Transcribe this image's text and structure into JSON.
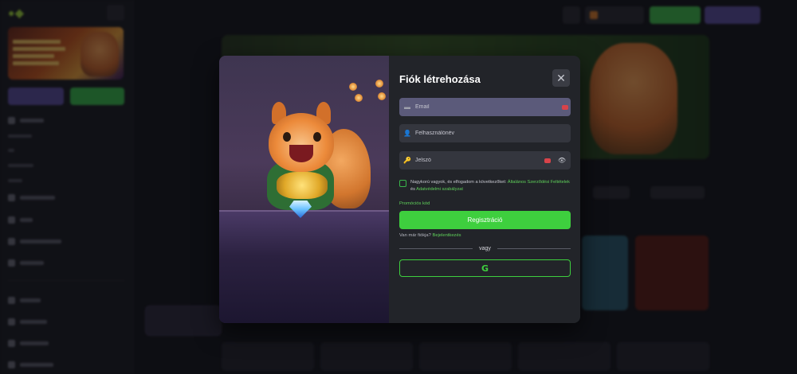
{
  "modal": {
    "title": "Fiók létrehozása",
    "close_icon": "close-icon",
    "fields": {
      "email": {
        "placeholder": "Email",
        "icon": "email-icon",
        "error": true
      },
      "username": {
        "placeholder": "Felhasználónév",
        "icon": "user-icon"
      },
      "password": {
        "placeholder": "Jelszó",
        "icon": "key-icon",
        "error": true,
        "toggle_icon": "eye-icon"
      }
    },
    "terms": {
      "text_1": "Nagykorú vagyok, és elfogadom a következőket:",
      "link_1": "Általános Szerződési Feltételek",
      "and": "és",
      "link_2": "Adatvédelmi szabályzat"
    },
    "promo_code_label": "Promóciós kód",
    "register_button": "Regisztráció",
    "have_account_text": "Van már fiókja?",
    "login_link": "Bejelentkezés",
    "divider_text": "vagy",
    "google_icon": "G"
  },
  "colors": {
    "accent_green": "#3ecf3e",
    "accent_purple": "#5a4e9a",
    "error_red": "#d8434a",
    "modal_bg": "#222429"
  }
}
